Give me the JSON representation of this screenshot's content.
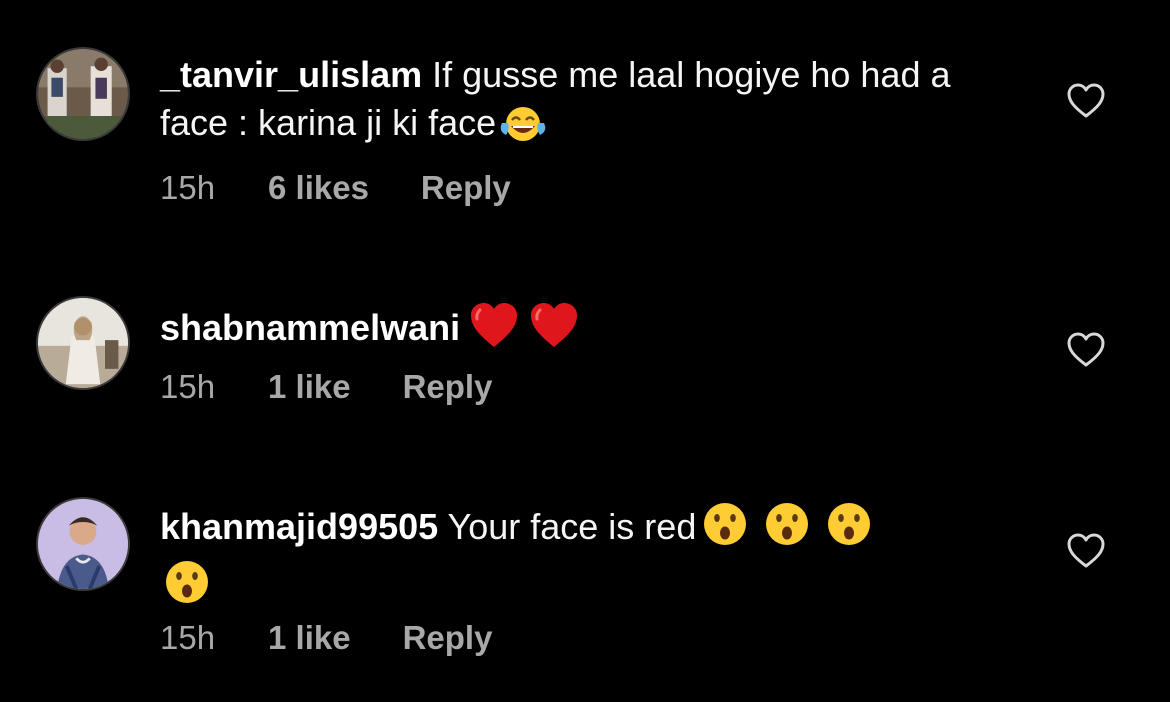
{
  "comments": [
    {
      "username": "_tanvir_ulislam",
      "text": "If gusse me laal hogiye ho had a face : karina ji ki face",
      "emoji": "face-with-tears-of-joy",
      "time": "15h",
      "likes": "6 likes",
      "reply": "Reply"
    },
    {
      "username": "shabnammelwani",
      "text": "",
      "emoji": "red-heart x2",
      "time": "15h",
      "likes": "1 like",
      "reply": "Reply"
    },
    {
      "username": "khanmajid99505",
      "text": "Your face is red",
      "emoji": "face-with-open-mouth x4",
      "time": "15h",
      "likes": "1 like",
      "reply": "Reply"
    }
  ],
  "colors": {
    "background": "#000000",
    "text": "#f5f5f5",
    "meta": "#a8a8a8"
  },
  "icons": {
    "like": "heart-outline-icon"
  }
}
